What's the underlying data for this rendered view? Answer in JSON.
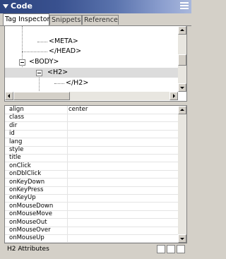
{
  "panel": {
    "title": "Code"
  },
  "tabs": [
    {
      "label": "Tag Inspector",
      "active": true
    },
    {
      "label": "Snippets",
      "active": false
    },
    {
      "label": "Reference",
      "active": false
    }
  ],
  "tree": {
    "nodes": [
      {
        "label": "<META>",
        "selected": false
      },
      {
        "label": "</HEAD>",
        "selected": false
      },
      {
        "label": "<BODY>",
        "selected": false
      },
      {
        "label": "<H2>",
        "selected": true
      },
      {
        "label": "</H2>",
        "selected": false
      }
    ]
  },
  "attributes": {
    "rows": [
      {
        "name": "align",
        "value": "center"
      },
      {
        "name": "class",
        "value": ""
      },
      {
        "name": "dir",
        "value": ""
      },
      {
        "name": "id",
        "value": ""
      },
      {
        "name": "lang",
        "value": ""
      },
      {
        "name": "style",
        "value": ""
      },
      {
        "name": "title",
        "value": ""
      },
      {
        "name": "onClick",
        "value": ""
      },
      {
        "name": "onDblClick",
        "value": ""
      },
      {
        "name": "onKeyDown",
        "value": ""
      },
      {
        "name": "onKeyPress",
        "value": ""
      },
      {
        "name": "onKeyUp",
        "value": ""
      },
      {
        "name": "onMouseDown",
        "value": ""
      },
      {
        "name": "onMouseMove",
        "value": ""
      },
      {
        "name": "onMouseOut",
        "value": ""
      },
      {
        "name": "onMouseOver",
        "value": ""
      },
      {
        "name": "onMouseUp",
        "value": ""
      }
    ]
  },
  "footer": {
    "label": "H2 Attributes"
  },
  "colors": {
    "titlebar": "#2d447f",
    "selection": "#dcdcdc",
    "panel": "#d4d0c8"
  }
}
